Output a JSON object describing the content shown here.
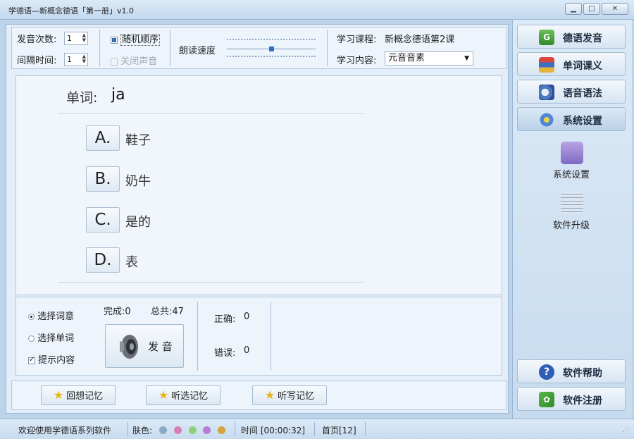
{
  "window": {
    "title": "学德语—新概念德语「第一册」v1.0",
    "minimize_icon": "minimize-icon",
    "maximize_icon": "maximize-icon",
    "close_icon": "close-icon"
  },
  "controls": {
    "pronounce_count_label": "发音次数:",
    "pronounce_count_value": "1",
    "interval_label": "间隔时间:",
    "interval_value": "1",
    "random_order_label": "随机顺序",
    "mute_label": "关闭声音",
    "read_speed_label": "朗读速度",
    "read_speed_level": 0.5,
    "course_label": "学习课程:",
    "course_value": "新概念德语第2课",
    "content_label": "学习内容:",
    "content_value": "元音音素"
  },
  "quiz": {
    "word_label": "单词:",
    "word_value": "ja",
    "options": [
      {
        "letter": "A.",
        "text": "鞋子"
      },
      {
        "letter": "B.",
        "text": "奶牛"
      },
      {
        "letter": "C.",
        "text": "是的"
      },
      {
        "letter": "D.",
        "text": "表"
      }
    ]
  },
  "practice": {
    "mode_meaning_label": "选择词意",
    "mode_word_label": "选择单词",
    "hint_label": "提示内容",
    "done_label": "完成:0",
    "total_label": "总共:47",
    "pronounce_button_label": "发 音",
    "correct_label": "正确:",
    "correct_value": "0",
    "wrong_label": "错误:",
    "wrong_value": "0"
  },
  "memory_buttons": [
    {
      "label": "回想记忆"
    },
    {
      "label": "听选记忆"
    },
    {
      "label": "听写记忆"
    }
  ],
  "sidebar": {
    "items": [
      {
        "label": "德语发音",
        "icon": "book-g-icon"
      },
      {
        "label": "单词课义",
        "icon": "books-icon"
      },
      {
        "label": "语音语法",
        "icon": "audio-book-icon"
      },
      {
        "label": "系统设置",
        "icon": "gears-icon"
      }
    ],
    "sub_items": [
      {
        "label": "系统设置",
        "icon": "folder-settings-icon"
      },
      {
        "label": "软件升级",
        "icon": "upgrade-icon"
      }
    ],
    "help_label": "软件帮助",
    "register_label": "软件注册"
  },
  "status": {
    "welcome": "欢迎使用学德语系列软件",
    "skin_label": "肤色:",
    "skin_colors": [
      "#8aa9c8",
      "#d87fb8",
      "#8fcf7a",
      "#b77bd6",
      "#d6a23a"
    ],
    "time_text": "时间 [00:00:32]",
    "page_text": "首页[12]"
  }
}
